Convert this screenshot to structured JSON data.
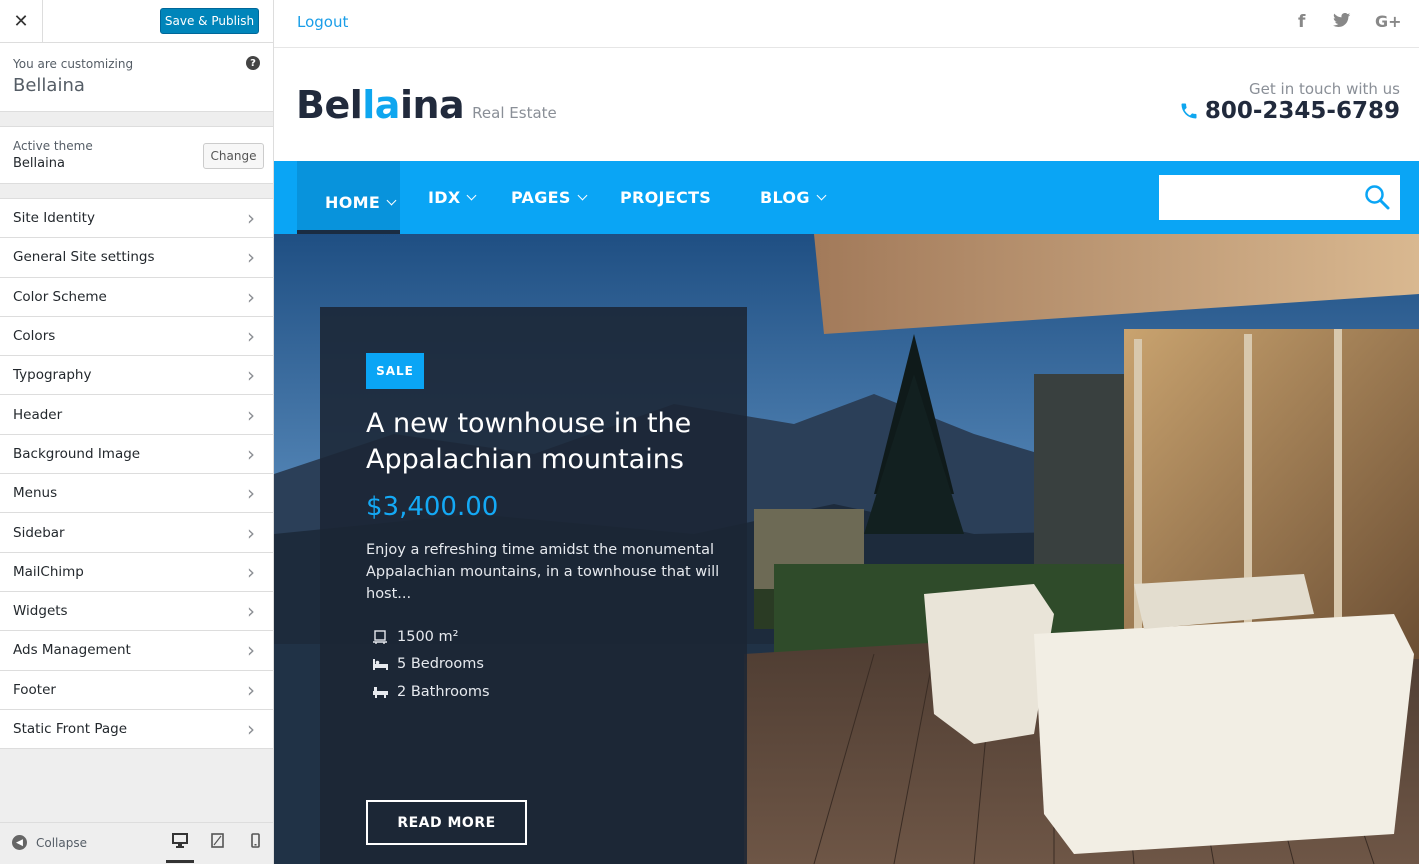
{
  "customizer": {
    "close_icon": "close-icon",
    "save_publish_label": "Save & Publish",
    "customizing_label": "You are customizing",
    "site_name": "Bellaina",
    "help_icon": "help-icon",
    "active_theme_label": "Active theme",
    "active_theme_name": "Bellaina",
    "change_label": "Change",
    "sections": [
      {
        "label": "Site Identity"
      },
      {
        "label": "General Site settings"
      },
      {
        "label": "Color Scheme"
      },
      {
        "label": "Colors"
      },
      {
        "label": "Typography"
      },
      {
        "label": "Header"
      },
      {
        "label": "Background Image"
      },
      {
        "label": "Menus"
      },
      {
        "label": "Sidebar"
      },
      {
        "label": "MailChimp"
      },
      {
        "label": "Widgets"
      },
      {
        "label": "Ads Management"
      },
      {
        "label": "Footer"
      },
      {
        "label": "Static Front Page"
      }
    ],
    "collapse_label": "Collapse",
    "devices": [
      "desktop",
      "tablet",
      "mobile"
    ],
    "active_device": "desktop"
  },
  "site": {
    "logout_label": "Logout",
    "social_icons": [
      "facebook-icon",
      "twitter-icon",
      "google-plus-icon"
    ],
    "brand_part1": "Bel",
    "brand_highlight": "la",
    "brand_part2": "ina",
    "brand_tagline": "Real Estate",
    "contact_label": "Get in touch with us",
    "phone": "800-2345-6789",
    "nav": [
      {
        "label": "HOME",
        "dropdown": true,
        "active": true
      },
      {
        "label": "IDX",
        "dropdown": true
      },
      {
        "label": "PAGES",
        "dropdown": true
      },
      {
        "label": "PROJECTS",
        "dropdown": false
      },
      {
        "label": "BLOG",
        "dropdown": true
      }
    ],
    "search_placeholder": "",
    "colors": {
      "accent": "#0aa5f5",
      "dark": "#212a3c",
      "wp_blue": "#0085ba"
    }
  },
  "hero": {
    "badge": "SALE",
    "title": "A new townhouse in the Appalachian mountains",
    "price": "$3,400.00",
    "description": "Enjoy a refreshing time amidst the monumental Appalachian mountains, in a townhouse that will host...",
    "features": [
      {
        "icon": "area-icon",
        "text": "1500 m²"
      },
      {
        "icon": "bed-icon",
        "text": "5 Bedrooms"
      },
      {
        "icon": "bath-icon",
        "text": "2 Bathrooms"
      }
    ],
    "cta_label": "READ MORE"
  }
}
